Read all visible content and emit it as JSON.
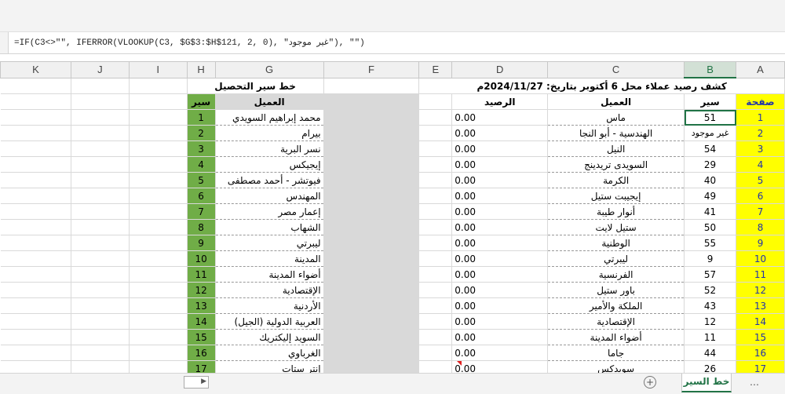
{
  "formula_bar": {
    "text": "=IF(C3<>\"\", IFERROR(VLOOKUP(C3, $G$3:$H$121, 2, 0), \"غير موجود\"), \"\")"
  },
  "columns": [
    "A",
    "B",
    "C",
    "D",
    "E",
    "F",
    "G",
    "H",
    "I",
    "J",
    "K"
  ],
  "selected_column": "B",
  "header_row": {
    "title_left": "كشف رصيد عملاء محل 6 أكتوبر بتاريخ: 2024/11/27م",
    "title_right": "خط سير التحصيل"
  },
  "labels": {
    "page": "صفحة",
    "route": "سير",
    "client": "العميل",
    "balance": "الرصيد",
    "client_g": "العميل",
    "route_h": "سير"
  },
  "rows": [
    {
      "a": "1",
      "b": "51",
      "c": "ماس",
      "d": "0.00",
      "g": "محمد إبراهيم السويدي",
      "h": "1"
    },
    {
      "a": "2",
      "b": "غير موجود",
      "c": "الهندسية - أبو النجا",
      "d": "0.00",
      "g": "بيرام",
      "h": "2"
    },
    {
      "a": "3",
      "b": "54",
      "c": "النيل",
      "d": "0.00",
      "g": "نسر البرية",
      "h": "3"
    },
    {
      "a": "4",
      "b": "29",
      "c": "السويدى تريدينج",
      "d": "0.00",
      "g": "إيجيكس",
      "h": "4"
    },
    {
      "a": "5",
      "b": "40",
      "c": "الكرمة",
      "d": "0.00",
      "g": "فيوتشر - أحمد مصطفى",
      "h": "5"
    },
    {
      "a": "6",
      "b": "49",
      "c": "إيجيبت ستيل",
      "d": "0.00",
      "g": "المهندس",
      "h": "6"
    },
    {
      "a": "7",
      "b": "41",
      "c": "أنوار طيبة",
      "d": "0.00",
      "g": "إعمار مصر",
      "h": "7"
    },
    {
      "a": "8",
      "b": "50",
      "c": "ستيل لايت",
      "d": "0.00",
      "g": "الشهاب",
      "h": "8"
    },
    {
      "a": "9",
      "b": "55",
      "c": "الوطنية",
      "d": "0.00",
      "g": "ليبرتي",
      "h": "9"
    },
    {
      "a": "10",
      "b": "9",
      "c": "ليبرتي",
      "d": "0.00",
      "g": "المدينة",
      "h": "10"
    },
    {
      "a": "11",
      "b": "57",
      "c": "الفرنسية",
      "d": "0.00",
      "g": "أضواء المدينة",
      "h": "11"
    },
    {
      "a": "12",
      "b": "52",
      "c": "باور ستيل",
      "d": "0.00",
      "g": "الإقتصادية",
      "h": "12"
    },
    {
      "a": "13",
      "b": "43",
      "c": "الملكة والأمير",
      "d": "0.00",
      "g": "الأردنية",
      "h": "13"
    },
    {
      "a": "14",
      "b": "12",
      "c": "الإقتصادية",
      "d": "0.00",
      "g": "العربية الدولية (الجيل)",
      "h": "14"
    },
    {
      "a": "15",
      "b": "11",
      "c": "أضواء المدينة",
      "d": "0.00",
      "g": "السويد إليكتريك",
      "h": "15"
    },
    {
      "a": "16",
      "b": "44",
      "c": "جاما",
      "d": "0.00",
      "g": "الغرباوي",
      "h": "16"
    },
    {
      "a": "17",
      "b": "26",
      "c": "سويدكس",
      "d": "0.00",
      "g": "إنتر ستات",
      "h": "17"
    }
  ],
  "sheet_tab": {
    "label": "خط السير"
  },
  "colors": {
    "yellow": "#ffff00",
    "green": "#70ad47",
    "gray": "#d9d9d9",
    "excel_green": "#217346"
  }
}
